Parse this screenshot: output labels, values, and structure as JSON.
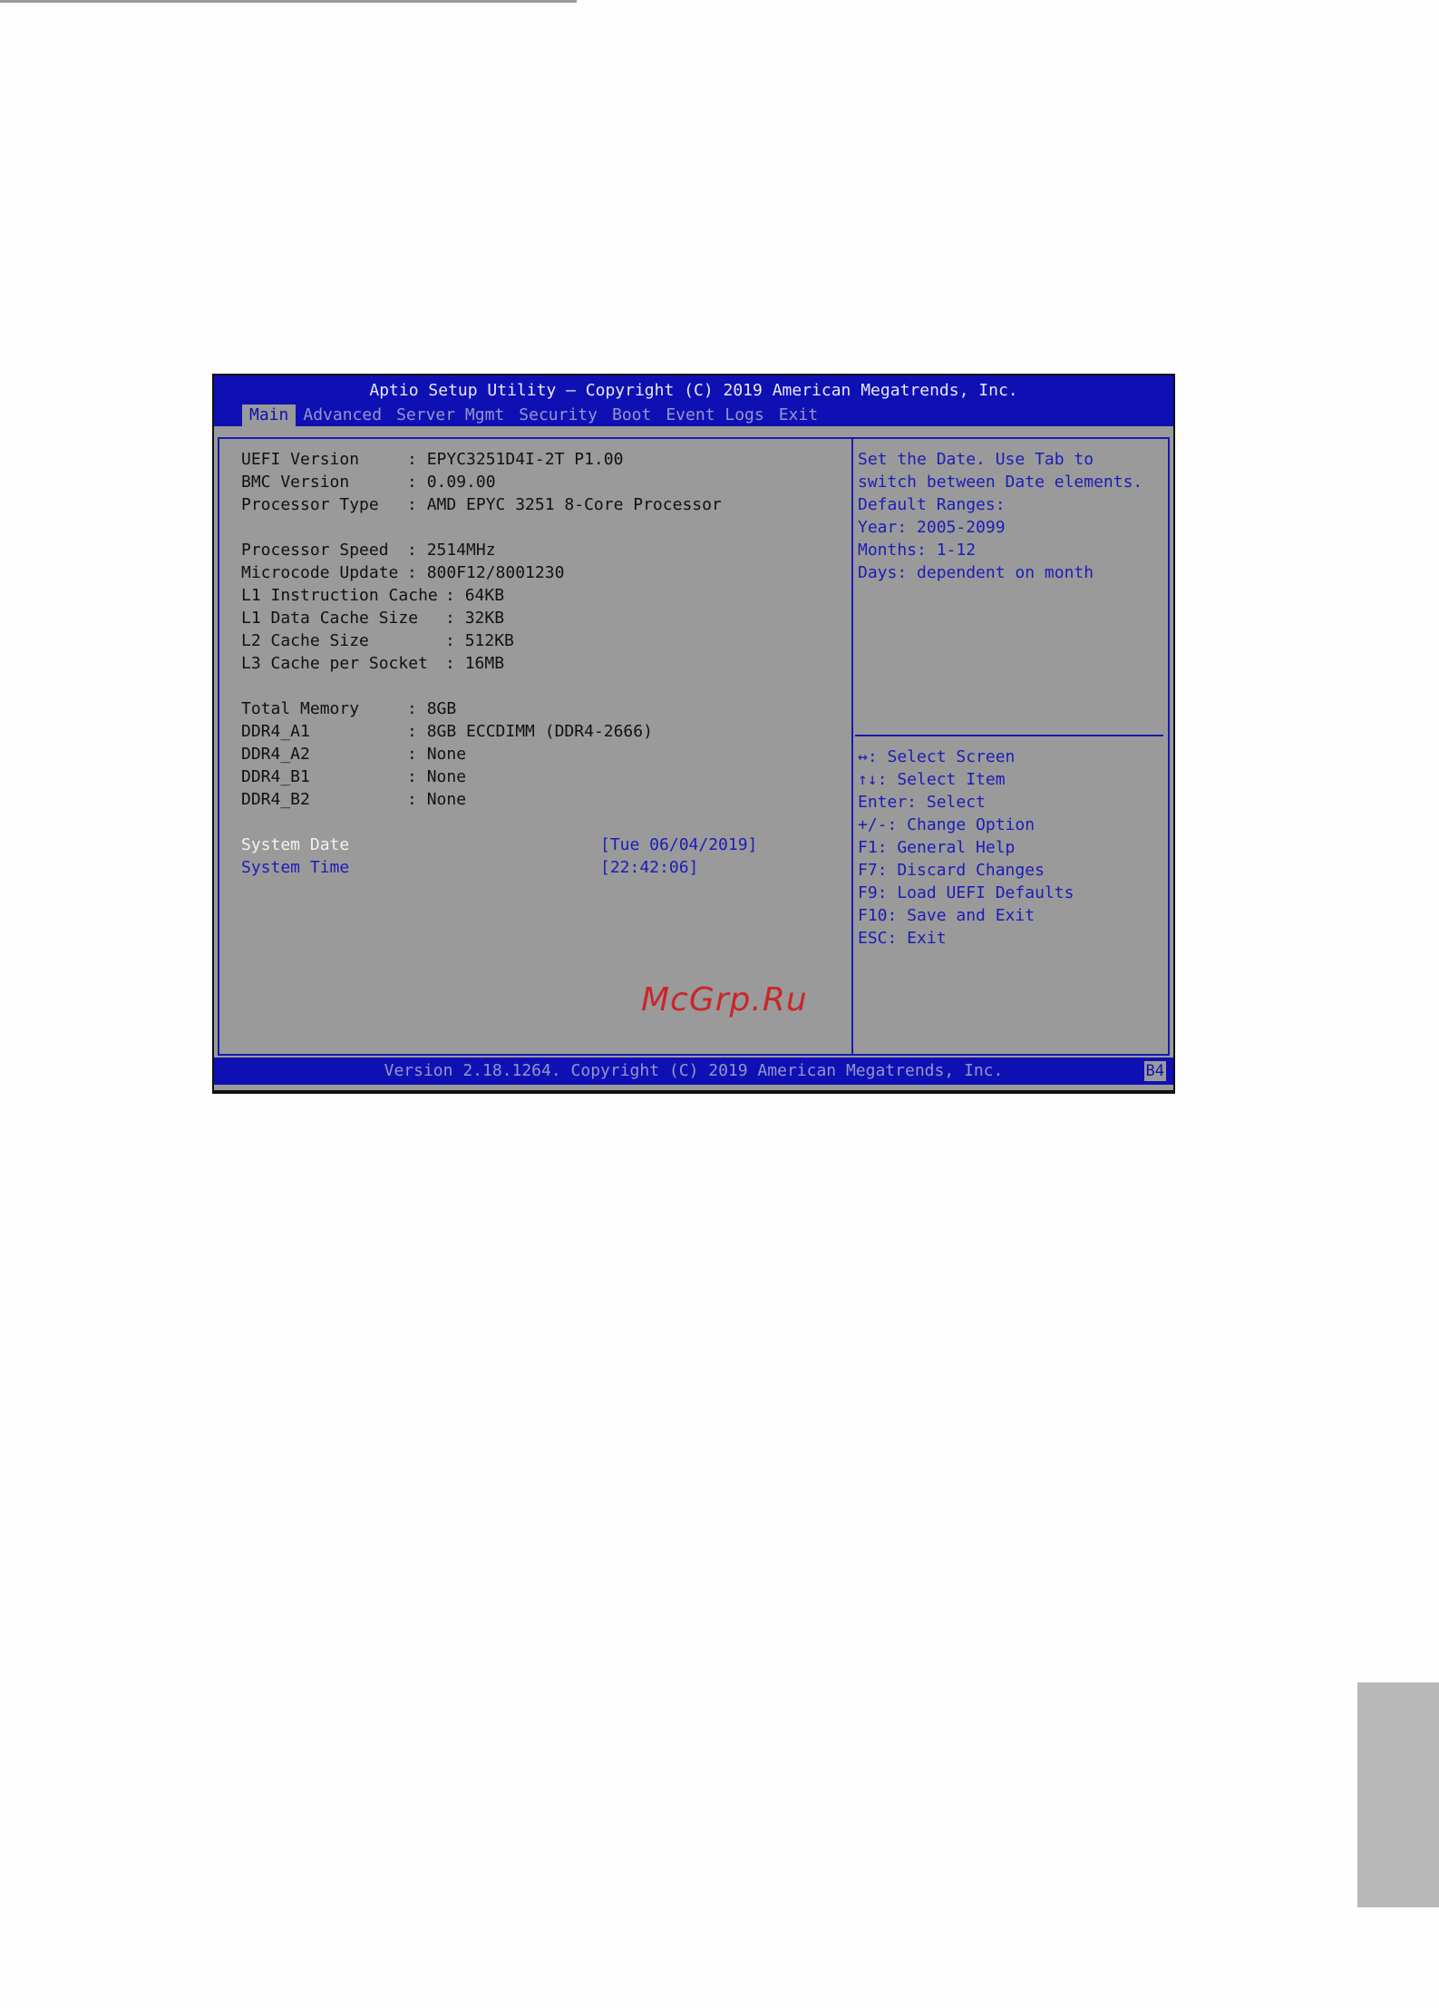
{
  "title": "Aptio Setup Utility – Copyright (C) 2019 American Megatrends, Inc.",
  "tabs": [
    "Main",
    "Advanced",
    "Server Mgmt",
    "Security",
    "Boot",
    "Event Logs",
    "Exit"
  ],
  "info": [
    {
      "label": "UEFI Version",
      "value": "EPYC3251D4I-2T P1.00"
    },
    {
      "label": "BMC Version",
      "value": "0.09.00"
    },
    {
      "label": "Processor Type",
      "value": "AMD EPYC 3251 8-Core Processor"
    },
    {
      "label": "Processor Speed",
      "value": "2514MHz"
    },
    {
      "label": "Microcode Update",
      "value": "800F12/8001230"
    },
    {
      "label": "L1 Instruction Cache",
      "value": "64KB"
    },
    {
      "label": "L1 Data Cache Size",
      "value": "32KB"
    },
    {
      "label": "L2 Cache Size",
      "value": "512KB"
    },
    {
      "label": "L3 Cache per Socket",
      "value": "16MB"
    },
    {
      "label": "Total Memory",
      "value": "8GB"
    },
    {
      "label": "DDR4_A1",
      "value": "8GB ECCDIMM (DDR4-2666)"
    },
    {
      "label": "DDR4_A2",
      "value": "None"
    },
    {
      "label": "DDR4_B1",
      "value": "None"
    },
    {
      "label": "DDR4_B2",
      "value": "None"
    }
  ],
  "settings": {
    "system_date": {
      "label": "System Date",
      "value": "[Tue 06/04/2019]"
    },
    "system_time": {
      "label": "System Time",
      "value": "[22:42:06]"
    }
  },
  "help_text": [
    "Set the Date. Use Tab to",
    "switch between Date elements.",
    "Default Ranges:",
    "Year: 2005-2099",
    "Months: 1-12",
    "Days: dependent on month"
  ],
  "key_help": [
    "↔: Select Screen",
    "↑↓: Select Item",
    "Enter: Select",
    "+/-: Change Option",
    "F1: General Help",
    "F7: Discard Changes",
    "F9: Load UEFI Defaults",
    "F10: Save and Exit",
    "ESC: Exit"
  ],
  "watermark": "McGrp.Ru",
  "footer": {
    "text": "Version 2.18.1264. Copyright (C) 2019 American Megatrends, Inc.",
    "badge": "B4"
  },
  "colors": {
    "header_blue": "#0f10b4",
    "panel_gray": "#9a9a9a",
    "link_blue": "#1b1db8",
    "watermark_red": "#c9272a"
  }
}
